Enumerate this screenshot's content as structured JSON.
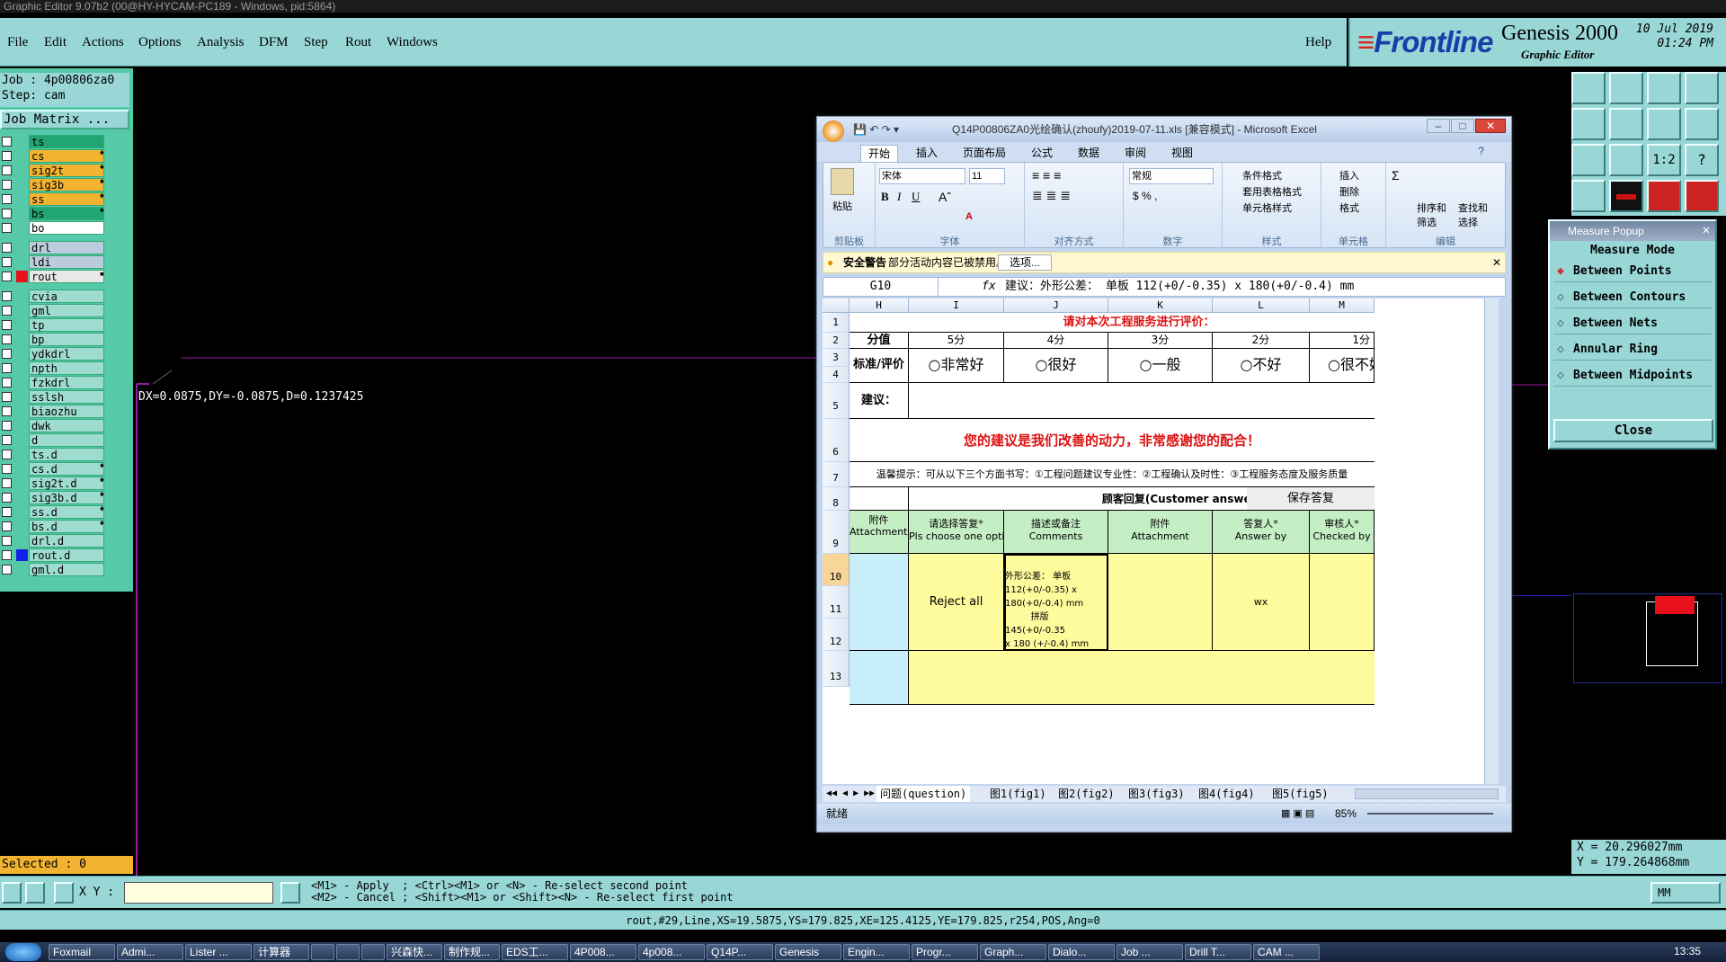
{
  "window_title": "Graphic Editor 9.07b2 (00@HY-HYCAM-PC189 - Windows, pid:5864)",
  "menu": [
    "File",
    "Edit",
    "Actions",
    "Options",
    "Analysis",
    "DFM",
    "Step",
    "Rout",
    "Windows"
  ],
  "help": "Help",
  "brand": {
    "logo": "Frontline",
    "product": "Genesis 2000",
    "sub": "Graphic Editor",
    "date": "10 Jul 2019",
    "time": "01:24 PM"
  },
  "job": {
    "job_line": "Job : 4p00806za0",
    "step_line": "Step: cam",
    "matrix_button": "Job Matrix ..."
  },
  "layers": [
    {
      "name": "ts",
      "color": "#1fa672",
      "mark": ""
    },
    {
      "name": "cs",
      "color": "#f2b430",
      "mark": "♦"
    },
    {
      "name": "sig2t",
      "color": "#f2b430",
      "mark": "♦"
    },
    {
      "name": "sig3b",
      "color": "#f2b430",
      "mark": "♦"
    },
    {
      "name": "ss",
      "color": "#f2b430",
      "mark": "♦"
    },
    {
      "name": "bs",
      "color": "#1fa672",
      "mark": "♦"
    },
    {
      "name": "bo",
      "color": "#ffffff",
      "mark": ""
    },
    {
      "name": "drl",
      "color": "#bcd",
      "mark": ""
    },
    {
      "name": "ldi",
      "color": "#bcd",
      "mark": ""
    },
    {
      "name": "rout",
      "color": "#e8e8e8",
      "mark": "▪"
    },
    {
      "name": "cvia",
      "color": "#9fdcd0",
      "mark": ""
    },
    {
      "name": "gml",
      "color": "#9fdcd0",
      "mark": ""
    },
    {
      "name": "tp",
      "color": "#9fdcd0",
      "mark": ""
    },
    {
      "name": "bp",
      "color": "#9fdcd0",
      "mark": ""
    },
    {
      "name": "ydkdrl",
      "color": "#9fdcd0",
      "mark": ""
    },
    {
      "name": "npth",
      "color": "#9fdcd0",
      "mark": ""
    },
    {
      "name": "fzkdrl",
      "color": "#9fdcd0",
      "mark": ""
    },
    {
      "name": "sslsh",
      "color": "#9fdcd0",
      "mark": ""
    },
    {
      "name": "biaozhu",
      "color": "#9fdcd0",
      "mark": ""
    },
    {
      "name": "dwk",
      "color": "#9fdcd0",
      "mark": ""
    },
    {
      "name": "d",
      "color": "#9fdcd0",
      "mark": ""
    },
    {
      "name": "ts.d",
      "color": "#9fdcd0",
      "mark": ""
    },
    {
      "name": "cs.d",
      "color": "#9fdcd0",
      "mark": "♦"
    },
    {
      "name": "sig2t.d",
      "color": "#9fdcd0",
      "mark": "♦"
    },
    {
      "name": "sig3b.d",
      "color": "#9fdcd0",
      "mark": "♦"
    },
    {
      "name": "ss.d",
      "color": "#9fdcd0",
      "mark": "♦"
    },
    {
      "name": "bs.d",
      "color": "#9fdcd0",
      "mark": "♦"
    },
    {
      "name": "drl.d",
      "color": "#9fdcd0",
      "mark": ""
    },
    {
      "name": "rout.d",
      "color": "#9fdcd0",
      "mark": ""
    },
    {
      "name": "gml.d",
      "color": "#9fdcd0",
      "mark": ""
    }
  ],
  "selected": "Selected : 0",
  "measure_readout": "DX=0.0875,DY=-0.0875,D=0.1237425",
  "xy_label": "X Y :",
  "cmd_help": "<M1> - Apply  ; <Ctrl><M1> or <N> - Re-select second point\n<M2> - Cancel ; <Shift><M1> or <Shift><N> - Re-select first point",
  "units": "MM",
  "status_line": "rout,#29,Line,XS=19.5875,YS=179.825,XE=125.4125,YE=179.825,r254,POS,Ang=0",
  "coords": {
    "x": "X = 20.296027mm",
    "y": "Y = 179.264868mm"
  },
  "measure_popup": {
    "title": "Measure Popup",
    "mode_label": "Measure Mode",
    "options": [
      "Between Points",
      "Between Contours",
      "Between Nets",
      "Annular Ring",
      "Between Midpoints"
    ],
    "close": "Close"
  },
  "excel": {
    "title": "Q14P00806ZA0光绘确认(zhoufy)2019-07-11.xls  [兼容模式] - Microsoft Excel",
    "tabs": [
      "开始",
      "插入",
      "页面布局",
      "公式",
      "数据",
      "审阅",
      "视图"
    ],
    "groups": [
      "剪贴板",
      "字体",
      "对齐方式",
      "数字",
      "样式",
      "单元格",
      "编辑"
    ],
    "font": "宋体",
    "size": "11",
    "numfmt": "常规",
    "paste": "粘贴",
    "style_items": [
      "条件格式",
      "套用表格格式",
      "单元格样式"
    ],
    "cell_items": [
      "插入",
      "删除",
      "格式"
    ],
    "edit_items": [
      "排序和筛选",
      "查找和选择"
    ],
    "security_title": "安全警告",
    "security_msg": "部分活动内容已被禁用。",
    "options_btn": "选项...",
    "namebox": "G10",
    "formula": "建议：外形公差： 单板 112(+0/-0.35) x 180(+0/-0.4) mm",
    "cols": [
      "H",
      "I",
      "J",
      "K",
      "L",
      "M"
    ],
    "rows": [
      "1",
      "2",
      "3",
      "4",
      "5",
      "6",
      "7",
      "8",
      "9",
      "10",
      "11",
      "12",
      "13"
    ],
    "title_row": "请对本次工程服务进行评价：",
    "score_label": "分值",
    "scores": [
      "5分",
      "4分",
      "3分",
      "2分",
      "1分"
    ],
    "rating_label": "标准/评价",
    "ratings": [
      "○非常好",
      "○很好",
      "○一般",
      "○不好",
      "○很不好"
    ],
    "suggest_label": "建议：",
    "thanks": "您的建议是我们改善的动力，非常感谢您的配合！",
    "tips": "温馨提示：可从以下三个方面书写：①工程问题建议专业性：②工程确认及时性：③工程服务态度及服务质量",
    "reply_title": "顾客回复(Customer answers)",
    "save_reply": "保存答复",
    "headers": [
      "附件\nAttachments",
      "请选择答复*\nPls choose one option",
      "描述或备注\nComments",
      "附件\nAttachment",
      "答复人*\nAnswer by",
      "审核人*\nChecked by"
    ],
    "reject": "Reject all",
    "comment": "外形公差： 单板\n112(+0/-0.35) x 180(+0/-0.4) mm\n         拼版145(+0/-0.35\nx 180 (+/-0.4) mm",
    "answer_by": "wx",
    "sheet_tabs": [
      "问题(question)",
      "图1(fig1)",
      "图2(fig2)",
      "图3(fig3)",
      "图4(fig4)",
      "图5(fig5)"
    ],
    "ready": "就绪",
    "zoom": "85%"
  },
  "taskbar": [
    "Foxmail",
    "Admi...",
    "Lister ...",
    "计算器",
    "",
    "",
    "",
    "兴森快...",
    "制作规...",
    "EDS工...",
    "4P008...",
    "4p008...",
    "Q14P...",
    "Genesis",
    "Engin...",
    "Progr...",
    "Graph...",
    "Dialo...",
    "Job ...",
    "Drill T...",
    "CAM ..."
  ],
  "clock": "13:35"
}
